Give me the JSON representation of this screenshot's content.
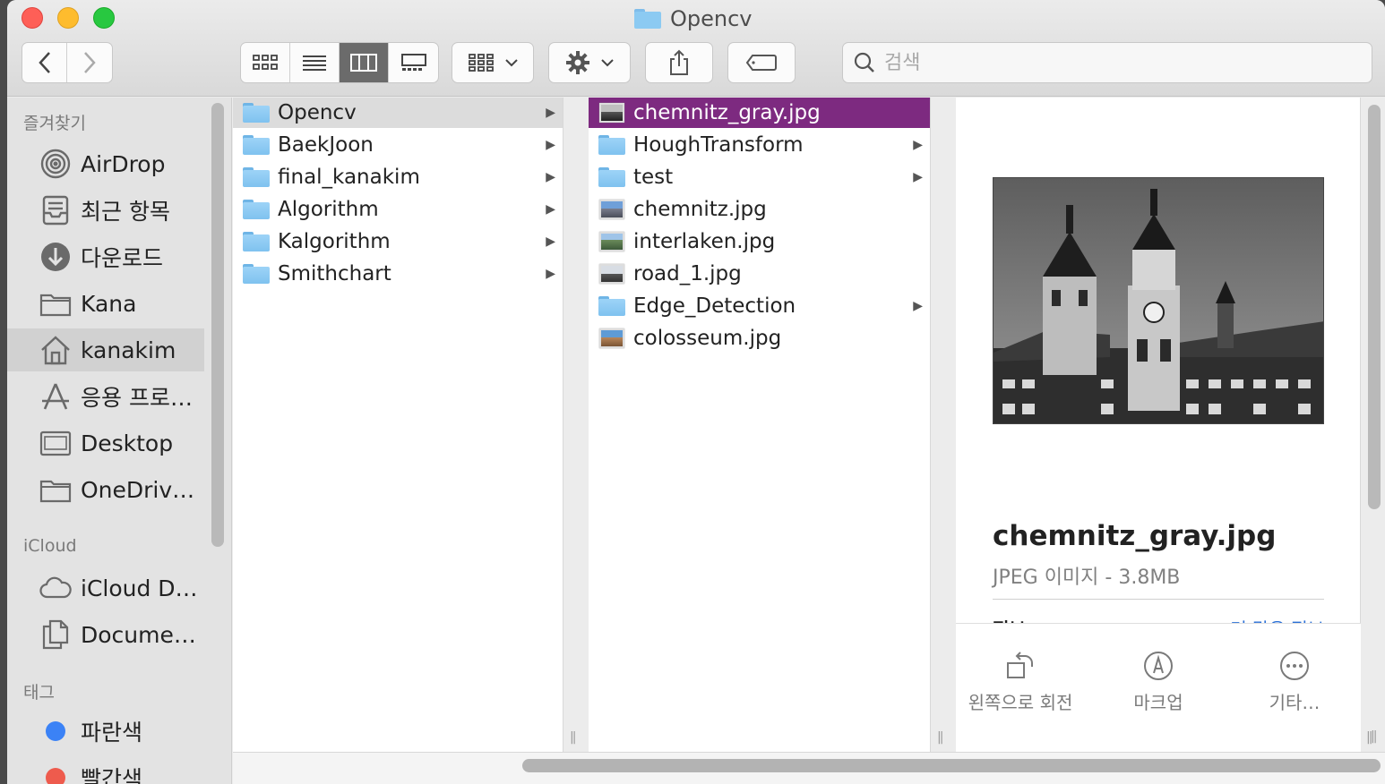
{
  "window": {
    "title": "Opencv"
  },
  "search": {
    "placeholder": "검색"
  },
  "sidebar": {
    "favorites_heading": "즐겨찾기",
    "icloud_heading": "iCloud",
    "tags_heading": "태그",
    "favorites": [
      {
        "label": "AirDrop",
        "icon": "airdrop-icon"
      },
      {
        "label": "최근 항목",
        "icon": "recents-icon"
      },
      {
        "label": "다운로드",
        "icon": "downloads-icon"
      },
      {
        "label": "Kana",
        "icon": "folder-icon"
      },
      {
        "label": "kanakim",
        "icon": "home-icon",
        "selected": true
      },
      {
        "label": "응용 프로…",
        "icon": "applications-icon"
      },
      {
        "label": "Desktop",
        "icon": "desktop-folder-icon"
      },
      {
        "label": "OneDriv…",
        "icon": "folder-icon"
      }
    ],
    "icloud": [
      {
        "label": "iCloud D…",
        "icon": "cloud-icon"
      },
      {
        "label": "Docume…",
        "icon": "documents-icon"
      }
    ],
    "tags": [
      {
        "label": "파란색",
        "color": "#3b82f6"
      },
      {
        "label": "빨간색",
        "color": "#ee5b4d"
      }
    ]
  },
  "columns": {
    "col1": [
      {
        "name": "Opencv",
        "type": "folder",
        "highlight": "gray"
      },
      {
        "name": "BaekJoon",
        "type": "folder"
      },
      {
        "name": "final_kanakim",
        "type": "folder"
      },
      {
        "name": "Algorithm",
        "type": "folder"
      },
      {
        "name": "Kalgorithm",
        "type": "folder"
      },
      {
        "name": "Smithchart",
        "type": "folder"
      }
    ],
    "col2": [
      {
        "name": "chemnitz_gray.jpg",
        "type": "image-gray",
        "highlight": "purple"
      },
      {
        "name": "HoughTransform",
        "type": "folder"
      },
      {
        "name": "test",
        "type": "folder"
      },
      {
        "name": "chemnitz.jpg",
        "type": "image"
      },
      {
        "name": "interlaken.jpg",
        "type": "image"
      },
      {
        "name": "road_1.jpg",
        "type": "image"
      },
      {
        "name": "Edge_Detection",
        "type": "folder"
      },
      {
        "name": "colosseum.jpg",
        "type": "image"
      }
    ]
  },
  "preview": {
    "filename": "chemnitz_gray.jpg",
    "meta": "JPEG 이미지 - 3.8MB",
    "info_label": "정보",
    "more_label": "더 많은 정보",
    "actions": [
      {
        "label": "왼쪽으로 회전",
        "icon": "rotate-left-icon"
      },
      {
        "label": "마크업",
        "icon": "markup-icon"
      },
      {
        "label": "기타…",
        "icon": "more-icon"
      }
    ]
  },
  "colors": {
    "selection_purple": "#7d2a80",
    "folder_blue": "#8ccaf2"
  }
}
